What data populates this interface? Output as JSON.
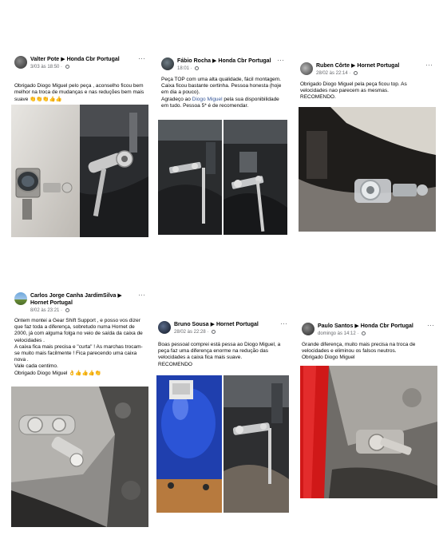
{
  "posts": [
    {
      "author": "Valter Pote",
      "group": "Honda Cbr Portugal",
      "time": "3/03 às 18:50",
      "text": "Obrigado  Diogo Miguel pelo peça  , aconselho ficou bem melhor na troca de mudanças  e  nas reduções  bem mais suave",
      "emoji": "👏👏👏👍👍"
    },
    {
      "author": "Fábio Rocha",
      "group": "Honda Cbr Portugal",
      "time": "18:01",
      "text_a": "Peça TOP com uma alta qualidade, fácil montagem. Caixa ficou bastante certinha. Pessoa honesta (hoje em dia a pouco).\nAgradeço ao ",
      "link": "Diogo Miguel",
      "text_b": "  pela sua disponibilidade em tudo. Pessoa 5* é de recomendar."
    },
    {
      "author": "Ruben Côrte",
      "group": "Hornet Portugal",
      "time": "28/02 às 22:14",
      "text": "Obrigado Diogo Miguel pela peça ficou top. As velocidades nao parecem as mesmas.\nRECOMENDO."
    },
    {
      "author": "Carlos Jorge Canha JardimSilva",
      "group": "Hornet Portugal",
      "time": "8/02 às 23:21",
      "text": "Ontem montei a Gear Shift Support , e posso vos dizer que faz toda a diferença, sobretudo numa Hornet de 2000, já com alguma folga no veio de saída da caixa de velocidades .\nA caixa fica mais precisa e \"curta\" ! As marchas trocam-se muito mais facilmente ! Fica parecendo uma caixa nova .\nVale cada centimo.\nObrigado Diogo Miguel",
      "emoji": "👌👍👍👍👏"
    },
    {
      "author": "Bruno Sousa",
      "group": "Hornet Portugal",
      "time": "28/02 às 22:28",
      "text": "Boas pessoal comprei está pessa ao Diogo Miguel, a peça faz uma diferença enorme na redução das velocidades a caixa fica mais suave.\nRECOMENDO"
    },
    {
      "author": "Paulo Santos",
      "group": "Honda Cbr Portugal",
      "time": "domingo às 14:12",
      "text": "Grande diferença, muito mais precisa na troca de velocidades e eliminou os falsos neutros.\nObrigado Diogo Miguel"
    }
  ],
  "ui": {
    "arrow": "▶",
    "more": "···",
    "time_sep": " · "
  },
  "colors": {
    "link": "#385898",
    "meta": "#65676b",
    "text": "#050505"
  }
}
